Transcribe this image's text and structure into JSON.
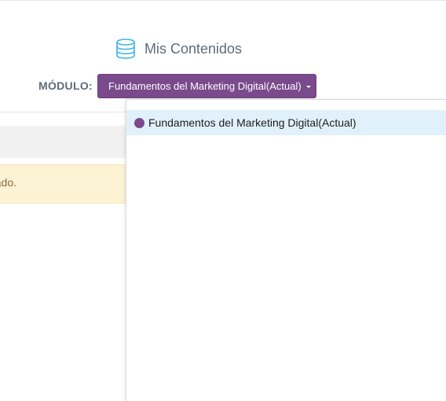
{
  "header": {
    "title": "Mis Contenidos",
    "icon": "database-icon"
  },
  "module": {
    "label": "MÓDULO:",
    "selected": "Fundamentos del Marketing Digital(Actual)",
    "accent_color": "#7a4a8c"
  },
  "alert": {
    "text_fragment": "ado."
  },
  "dropdown": {
    "items": [
      {
        "label": "Fundamentos del Marketing Digital(Actual)",
        "active": true,
        "dot_color": "#7a4a8c"
      }
    ]
  }
}
